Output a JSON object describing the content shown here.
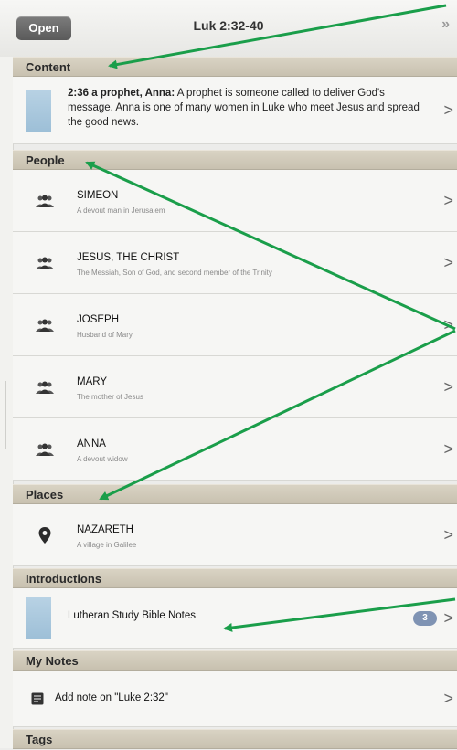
{
  "toolbar": {
    "open_label": "Open",
    "title": "Luk 2:32-40",
    "expand_icon": "double-chevron-right-icon"
  },
  "sections": {
    "content": "Content",
    "people": "People",
    "places": "Places",
    "introductions": "Introductions",
    "my_notes": "My Notes",
    "tags": "Tags"
  },
  "content_item": {
    "ref": "2:36 a prophet, Anna:",
    "text": " A prophet is someone called to deliver God's message. Anna is one of many women in Luke who meet Jesus and spread the good news."
  },
  "people": [
    {
      "name": "SIMEON",
      "desc": "A devout man in Jerusalem"
    },
    {
      "name": "JESUS, THE CHRIST",
      "desc": "The Messiah, Son of God, and second member of the Trinity"
    },
    {
      "name": "JOSEPH",
      "desc": "Husband of Mary"
    },
    {
      "name": "MARY",
      "desc": "The mother of Jesus"
    },
    {
      "name": "ANNA",
      "desc": "A devout widow"
    }
  ],
  "places": [
    {
      "name": "NAZARETH",
      "desc": "A village in Galilee"
    }
  ],
  "introductions": [
    {
      "label": "Lutheran Study Bible Notes",
      "count": "3"
    }
  ],
  "notes": {
    "add_label": "Add note on \"Luke 2:32\""
  },
  "chevron": ">",
  "colors": {
    "arrow": "#1a9e4a",
    "badge": "#7f93b3",
    "section_header": "#cfc8b7"
  }
}
